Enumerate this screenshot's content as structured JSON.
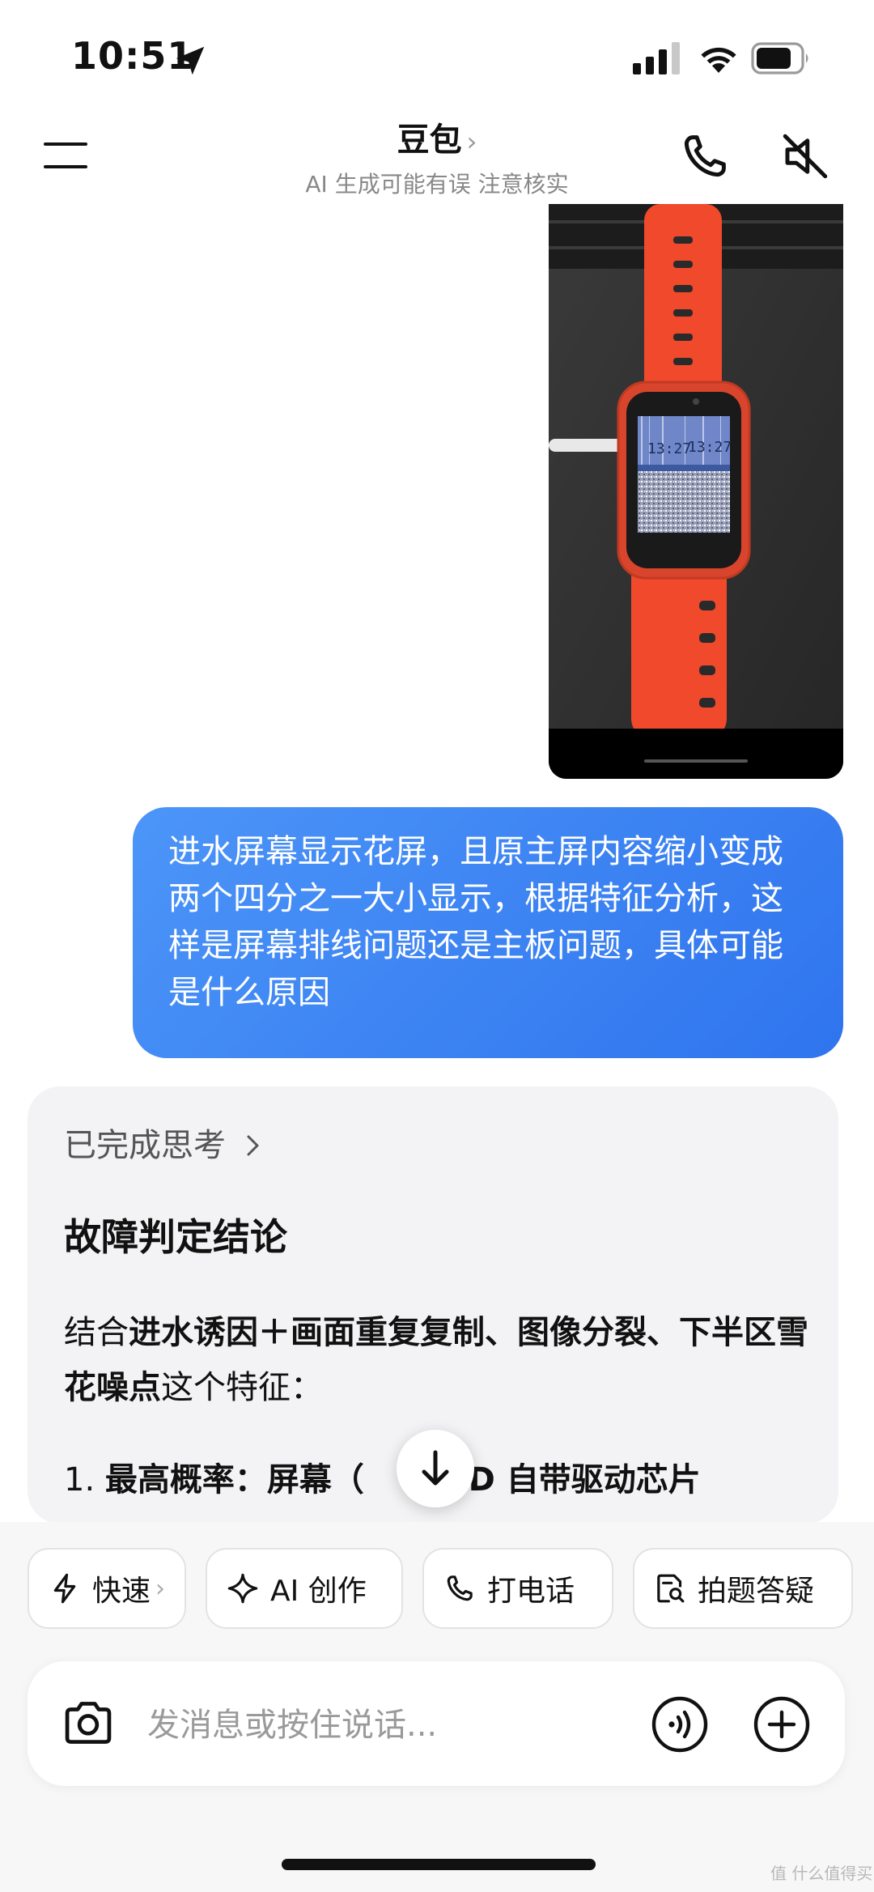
{
  "status_bar": {
    "time": "10:51"
  },
  "header": {
    "title": "豆包",
    "title_chevron": "›",
    "subtitle": "AI 生成可能有误 注意核实"
  },
  "image_message": {
    "watch_time_left": "13:27",
    "watch_time_right": "13:27"
  },
  "user_message": {
    "text": "进水屏幕显示花屏，且原主屏内容缩小变成两个四分之一大小显示，根据特征分析，这样是屏幕排线问题还是主板问题，具体可能是什么原因"
  },
  "ai_response": {
    "thinking_label": "已完成思考",
    "heading": "故障判定结论",
    "para_prefix": "结合",
    "para_bold_1": "进水诱因＋画面重复复制、图像分裂、下半区雪花噪点",
    "para_suffix": "这个特征：",
    "list_number": "1.",
    "list_bold": "最高概率：屏幕（",
    "list_tail": " LCD 自带驱动芯片"
  },
  "chips": [
    {
      "label": "快速",
      "icon": "lightning-icon",
      "chevron": "›"
    },
    {
      "label": "AI 创作",
      "icon": "sparkle-icon"
    },
    {
      "label": "打电话",
      "icon": "phone-icon"
    },
    {
      "label": "拍题答疑",
      "icon": "scan-question-icon"
    }
  ],
  "input": {
    "placeholder": "发消息或按住说话..."
  },
  "watermark": "值 什么值得买",
  "colors": {
    "accent_blue": "#3b82f6",
    "card_bg": "#f3f3f5",
    "watch_orange": "#f0492c"
  }
}
